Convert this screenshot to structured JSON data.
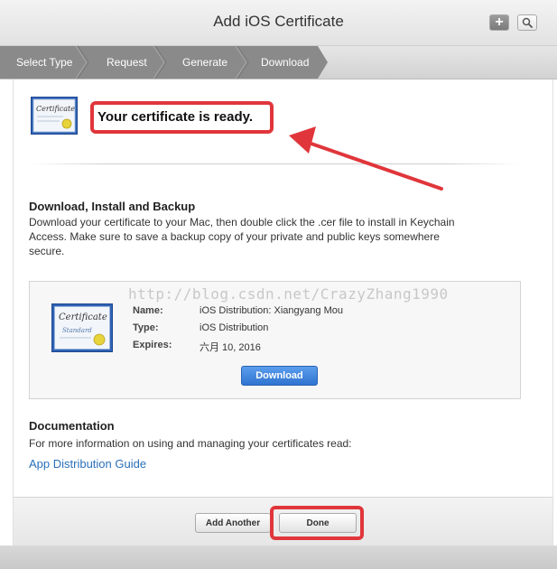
{
  "window": {
    "title": "Add iOS Certificate"
  },
  "toolbar": {
    "add_icon": "plus-icon",
    "search_icon": "search-icon"
  },
  "steps": [
    "Select Type",
    "Request",
    "Generate",
    "Download"
  ],
  "status": {
    "message": "Your certificate is ready."
  },
  "download_section": {
    "heading": "Download, Install and Backup",
    "line1": "Download your certificate to your Mac, then double click the .cer file to install in Keychain",
    "line2": "Access. Make sure to save a backup copy of your private and public keys somewhere",
    "line3": "secure."
  },
  "certificate": {
    "watermark": "http://blog.csdn.net/CrazyZhang1990",
    "name_label": "Name:",
    "name_value": "iOS Distribution: Xiangyang Mou",
    "type_label": "Type:",
    "type_value": "iOS Distribution",
    "expires_label": "Expires:",
    "expires_value": "六月 10, 2016",
    "download_label": "Download",
    "icon_text": "Certificate",
    "icon_subtext": "Standard"
  },
  "documentation": {
    "heading": "Documentation",
    "text": "For more information on using and managing your certificates read:",
    "link": "App Distribution Guide"
  },
  "footer": {
    "add_another_label": "Add Another",
    "done_label": "Done"
  },
  "colors": {
    "highlight": "#e0363b",
    "primary_button": "#2f74d0",
    "link": "#2a6fb8",
    "step_bar": "#8a8a8a"
  }
}
